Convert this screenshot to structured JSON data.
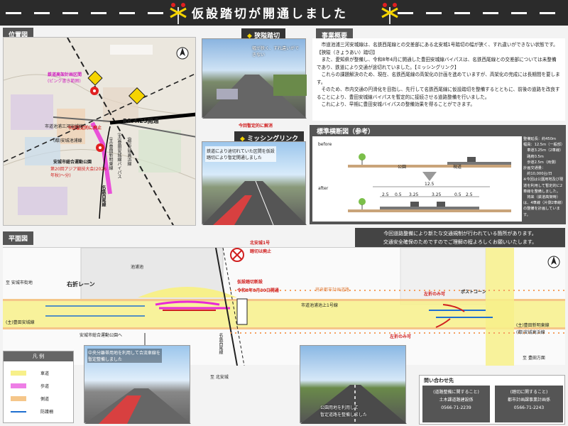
{
  "header": {
    "title": "仮設踏切が開通しました"
  },
  "location_map": {
    "label": "位置図",
    "line_label": "名鉄西尾線",
    "route_label": "豊田安城バイパス",
    "date_label": "R8.4.25開通",
    "road_label_1": "(主)豊田安城線バイパス",
    "road_label_2": "(都)安城高浜線",
    "road_label_3": "(主)豊田新明東線",
    "road_label_4": "(都)安城池浦線",
    "sub_label": "市道池浦三河安城線",
    "park_label": "安城市総合運動公園",
    "note_1": "鉄道高架計画区間",
    "note_2": "(ピンク書き範囲)",
    "note_3": "第20回アジア競技大会(2026年秋)～分)",
    "red_label": "今回暫定的に廃止"
  },
  "narrow_crossing": {
    "label": "狭隘踏切",
    "caption": "幅が狭く、すれ違いができない"
  },
  "missing_link": {
    "label": "ミッシングリンク",
    "red_label": "今回暫定的に解消",
    "caption": "鉄道により途切れていた区間を仮設踏切により暫定開通しました"
  },
  "overview": {
    "label": "事業概要",
    "paragraphs": [
      "市道池浦三河安城線は、名鉄西尾線との交差部にある北安城1号踏切の幅が狭く、すれ違いができない状態です。【狭隘（きょうあい）踏切】",
      "また、愛知県が整備し、令和8年4月に開通した豊田安城線バイパスは、名鉄西尾線との交差部については未整備であり、鉄道により交通が途切れていました。【ミッシングリンク】",
      "これらの課題解決のため、現在、名鉄西尾線の高架化の計画を進めていますが、高架化の完成には長期間を要します。",
      "そのため、市内交通の円滑化を目指し、先行して名鉄西尾線に仮設踏切を整備するとともに、前後の道路を改良することにより、豊田安城線バイパスを暫定的に接続させる道路整備を行いました。",
      "これにより、早期に豊田安城バイパスの整備効果を得ることができます。"
    ]
  },
  "cross_section": {
    "label": "標準横断図（参考）",
    "before": "before",
    "after": "after",
    "park": "公園",
    "sidewalk": "現道",
    "total": "12.5",
    "dims": [
      "2.5",
      "0.5",
      "3.25",
      "3.25",
      "0.5",
      "2.5"
    ],
    "specs": [
      "整備延長：約450m",
      "幅員：12.5m（一般部）",
      "　車道3.25m（2車線）",
      "　路肩0.5m",
      "　歩道2.5m（両側）",
      "計画交通量：",
      "　約10,000台/日",
      "",
      "※今回は公園用地及び現道を利用して暫定的に2車線を整備しました。",
      "　将来（鉄道高架時）は、4車線（片側2車線）の整備を計画しています。"
    ]
  },
  "plan": {
    "label": "平面図",
    "notice_1": "今回道路整備により新たな交通規制が行われている箇所があります。",
    "notice_2": "交通安全確保のためですのでご理解の程よろしくお願いいたします。",
    "abolish_1": "北安城1号",
    "abolish_2": "踏切は廃止",
    "new_crossing_1": "仮設踏切新設",
    "new_crossing_2": "令和8年8月30日開通",
    "right_lane": "右折レーン",
    "post_cone": "ポストコーン",
    "left_only_1": "左折のみ可",
    "left_only_2": "左折のみ可",
    "to_anjo_city": "至 安城市街地",
    "to_kitaanjo": "至 北安城",
    "to_park": "安城市総合運動公園へ",
    "road_toyota": "(主)豊田安城線",
    "road_ikeura": "市道池浦池上1号線",
    "road_ikeura2": "池浦池",
    "road_shinmei": "(主)豊田新明東線",
    "road_takahama": "(都)安城高浜線",
    "plan_label": "将来都市計画道路",
    "meitetsu": "名鉄西尾線",
    "to_toyota": "至 豊田方面"
  },
  "legend": {
    "label": "凡 例",
    "items": [
      {
        "label": "車道",
        "color": "#f7f08a"
      },
      {
        "label": "歩道",
        "color": "#ee7ee6"
      },
      {
        "label": "側道",
        "color": "#f5c68a"
      },
      {
        "label": "防護柵",
        "color": "#1f6fd0"
      }
    ]
  },
  "photo_bottom_1": {
    "caption": "中央分離帯用地を利用して合流車線を暫定整備しました"
  },
  "photo_bottom_2": {
    "caption_1": "公園用地を利用して",
    "caption_2": "暫定道路を整備しました"
  },
  "contact": {
    "label": "問い合わせ先",
    "left_1": "(道路整備に関すること)",
    "left_2": "土木課道路建設係",
    "left_3": "0566-71-2239",
    "right_1": "(踏切に関すること)",
    "right_2": "都市計画課事業計画係",
    "right_3": "0566-71-2243"
  }
}
